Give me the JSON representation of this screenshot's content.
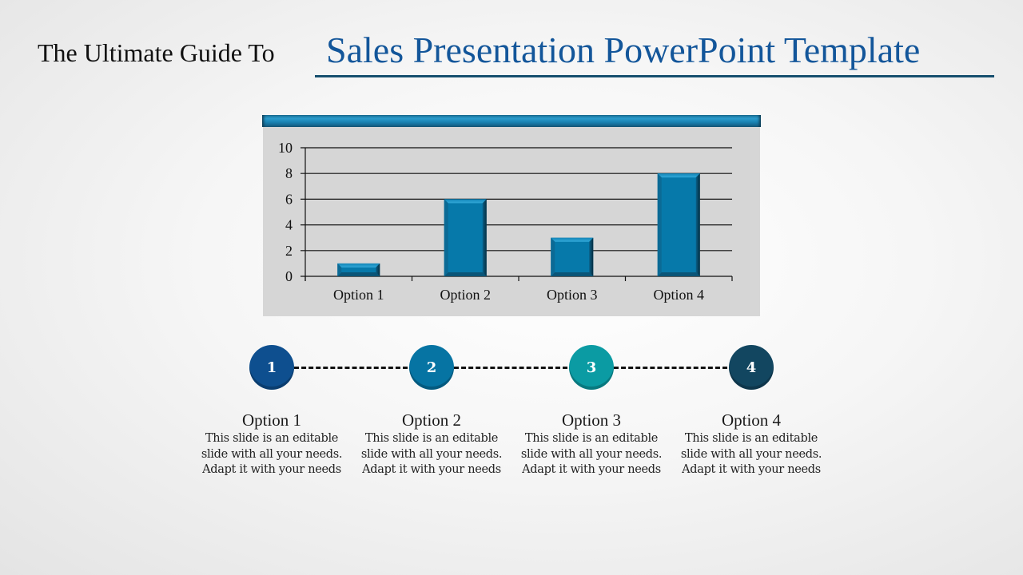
{
  "title": {
    "prefix": "The Ultimate Guide To",
    "main": "Sales Presentation PowerPoint Template"
  },
  "colors": {
    "title_blue": "#13569a",
    "underline": "#164f6e",
    "bar_fill": "#0679aa",
    "panel_bg": "#d6d6d6",
    "step_colors": [
      "#0e4f8f",
      "#0674a3",
      "#0b9ba3",
      "#124660"
    ]
  },
  "chart_data": {
    "type": "bar",
    "title": "",
    "xlabel": "",
    "ylabel": "",
    "categories": [
      "Option 1",
      "Option 2",
      "Option 3",
      "Option 4"
    ],
    "values": [
      1,
      6,
      3,
      8
    ],
    "ylim": [
      0,
      10
    ],
    "yticks": [
      0,
      2,
      4,
      6,
      8,
      10
    ],
    "grid": true,
    "legend": "none"
  },
  "steps": [
    {
      "number": "1",
      "title": "Option 1",
      "desc": [
        "This slide is an editable",
        "slide with all your needs.",
        "Adapt it with your needs"
      ]
    },
    {
      "number": "2",
      "title": "Option 2",
      "desc": [
        "This slide is an editable",
        "slide with all your needs.",
        "Adapt it with your needs"
      ]
    },
    {
      "number": "3",
      "title": "Option 3",
      "desc": [
        "This slide is an editable",
        "slide with all your needs.",
        "Adapt it with your needs"
      ]
    },
    {
      "number": "4",
      "title": "Option 4",
      "desc": [
        "This slide is an editable",
        "slide with all your needs.",
        "Adapt it with your needs"
      ]
    }
  ]
}
